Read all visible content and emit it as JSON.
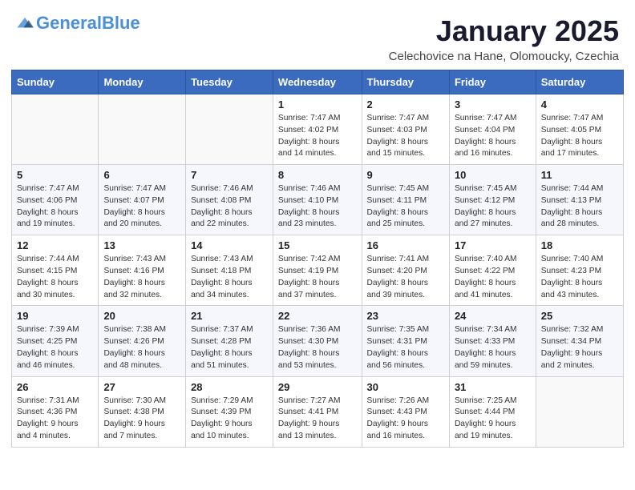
{
  "header": {
    "logo_general": "General",
    "logo_blue": "Blue",
    "month_title": "January 2025",
    "location": "Celechovice na Hane, Olomoucky, Czechia"
  },
  "weekdays": [
    "Sunday",
    "Monday",
    "Tuesday",
    "Wednesday",
    "Thursday",
    "Friday",
    "Saturday"
  ],
  "weeks": [
    [
      {
        "day": "",
        "info": ""
      },
      {
        "day": "",
        "info": ""
      },
      {
        "day": "",
        "info": ""
      },
      {
        "day": "1",
        "info": "Sunrise: 7:47 AM\nSunset: 4:02 PM\nDaylight: 8 hours\nand 14 minutes."
      },
      {
        "day": "2",
        "info": "Sunrise: 7:47 AM\nSunset: 4:03 PM\nDaylight: 8 hours\nand 15 minutes."
      },
      {
        "day": "3",
        "info": "Sunrise: 7:47 AM\nSunset: 4:04 PM\nDaylight: 8 hours\nand 16 minutes."
      },
      {
        "day": "4",
        "info": "Sunrise: 7:47 AM\nSunset: 4:05 PM\nDaylight: 8 hours\nand 17 minutes."
      }
    ],
    [
      {
        "day": "5",
        "info": "Sunrise: 7:47 AM\nSunset: 4:06 PM\nDaylight: 8 hours\nand 19 minutes."
      },
      {
        "day": "6",
        "info": "Sunrise: 7:47 AM\nSunset: 4:07 PM\nDaylight: 8 hours\nand 20 minutes."
      },
      {
        "day": "7",
        "info": "Sunrise: 7:46 AM\nSunset: 4:08 PM\nDaylight: 8 hours\nand 22 minutes."
      },
      {
        "day": "8",
        "info": "Sunrise: 7:46 AM\nSunset: 4:10 PM\nDaylight: 8 hours\nand 23 minutes."
      },
      {
        "day": "9",
        "info": "Sunrise: 7:45 AM\nSunset: 4:11 PM\nDaylight: 8 hours\nand 25 minutes."
      },
      {
        "day": "10",
        "info": "Sunrise: 7:45 AM\nSunset: 4:12 PM\nDaylight: 8 hours\nand 27 minutes."
      },
      {
        "day": "11",
        "info": "Sunrise: 7:44 AM\nSunset: 4:13 PM\nDaylight: 8 hours\nand 28 minutes."
      }
    ],
    [
      {
        "day": "12",
        "info": "Sunrise: 7:44 AM\nSunset: 4:15 PM\nDaylight: 8 hours\nand 30 minutes."
      },
      {
        "day": "13",
        "info": "Sunrise: 7:43 AM\nSunset: 4:16 PM\nDaylight: 8 hours\nand 32 minutes."
      },
      {
        "day": "14",
        "info": "Sunrise: 7:43 AM\nSunset: 4:18 PM\nDaylight: 8 hours\nand 34 minutes."
      },
      {
        "day": "15",
        "info": "Sunrise: 7:42 AM\nSunset: 4:19 PM\nDaylight: 8 hours\nand 37 minutes."
      },
      {
        "day": "16",
        "info": "Sunrise: 7:41 AM\nSunset: 4:20 PM\nDaylight: 8 hours\nand 39 minutes."
      },
      {
        "day": "17",
        "info": "Sunrise: 7:40 AM\nSunset: 4:22 PM\nDaylight: 8 hours\nand 41 minutes."
      },
      {
        "day": "18",
        "info": "Sunrise: 7:40 AM\nSunset: 4:23 PM\nDaylight: 8 hours\nand 43 minutes."
      }
    ],
    [
      {
        "day": "19",
        "info": "Sunrise: 7:39 AM\nSunset: 4:25 PM\nDaylight: 8 hours\nand 46 minutes."
      },
      {
        "day": "20",
        "info": "Sunrise: 7:38 AM\nSunset: 4:26 PM\nDaylight: 8 hours\nand 48 minutes."
      },
      {
        "day": "21",
        "info": "Sunrise: 7:37 AM\nSunset: 4:28 PM\nDaylight: 8 hours\nand 51 minutes."
      },
      {
        "day": "22",
        "info": "Sunrise: 7:36 AM\nSunset: 4:30 PM\nDaylight: 8 hours\nand 53 minutes."
      },
      {
        "day": "23",
        "info": "Sunrise: 7:35 AM\nSunset: 4:31 PM\nDaylight: 8 hours\nand 56 minutes."
      },
      {
        "day": "24",
        "info": "Sunrise: 7:34 AM\nSunset: 4:33 PM\nDaylight: 8 hours\nand 59 minutes."
      },
      {
        "day": "25",
        "info": "Sunrise: 7:32 AM\nSunset: 4:34 PM\nDaylight: 9 hours\nand 2 minutes."
      }
    ],
    [
      {
        "day": "26",
        "info": "Sunrise: 7:31 AM\nSunset: 4:36 PM\nDaylight: 9 hours\nand 4 minutes."
      },
      {
        "day": "27",
        "info": "Sunrise: 7:30 AM\nSunset: 4:38 PM\nDaylight: 9 hours\nand 7 minutes."
      },
      {
        "day": "28",
        "info": "Sunrise: 7:29 AM\nSunset: 4:39 PM\nDaylight: 9 hours\nand 10 minutes."
      },
      {
        "day": "29",
        "info": "Sunrise: 7:27 AM\nSunset: 4:41 PM\nDaylight: 9 hours\nand 13 minutes."
      },
      {
        "day": "30",
        "info": "Sunrise: 7:26 AM\nSunset: 4:43 PM\nDaylight: 9 hours\nand 16 minutes."
      },
      {
        "day": "31",
        "info": "Sunrise: 7:25 AM\nSunset: 4:44 PM\nDaylight: 9 hours\nand 19 minutes."
      },
      {
        "day": "",
        "info": ""
      }
    ]
  ]
}
